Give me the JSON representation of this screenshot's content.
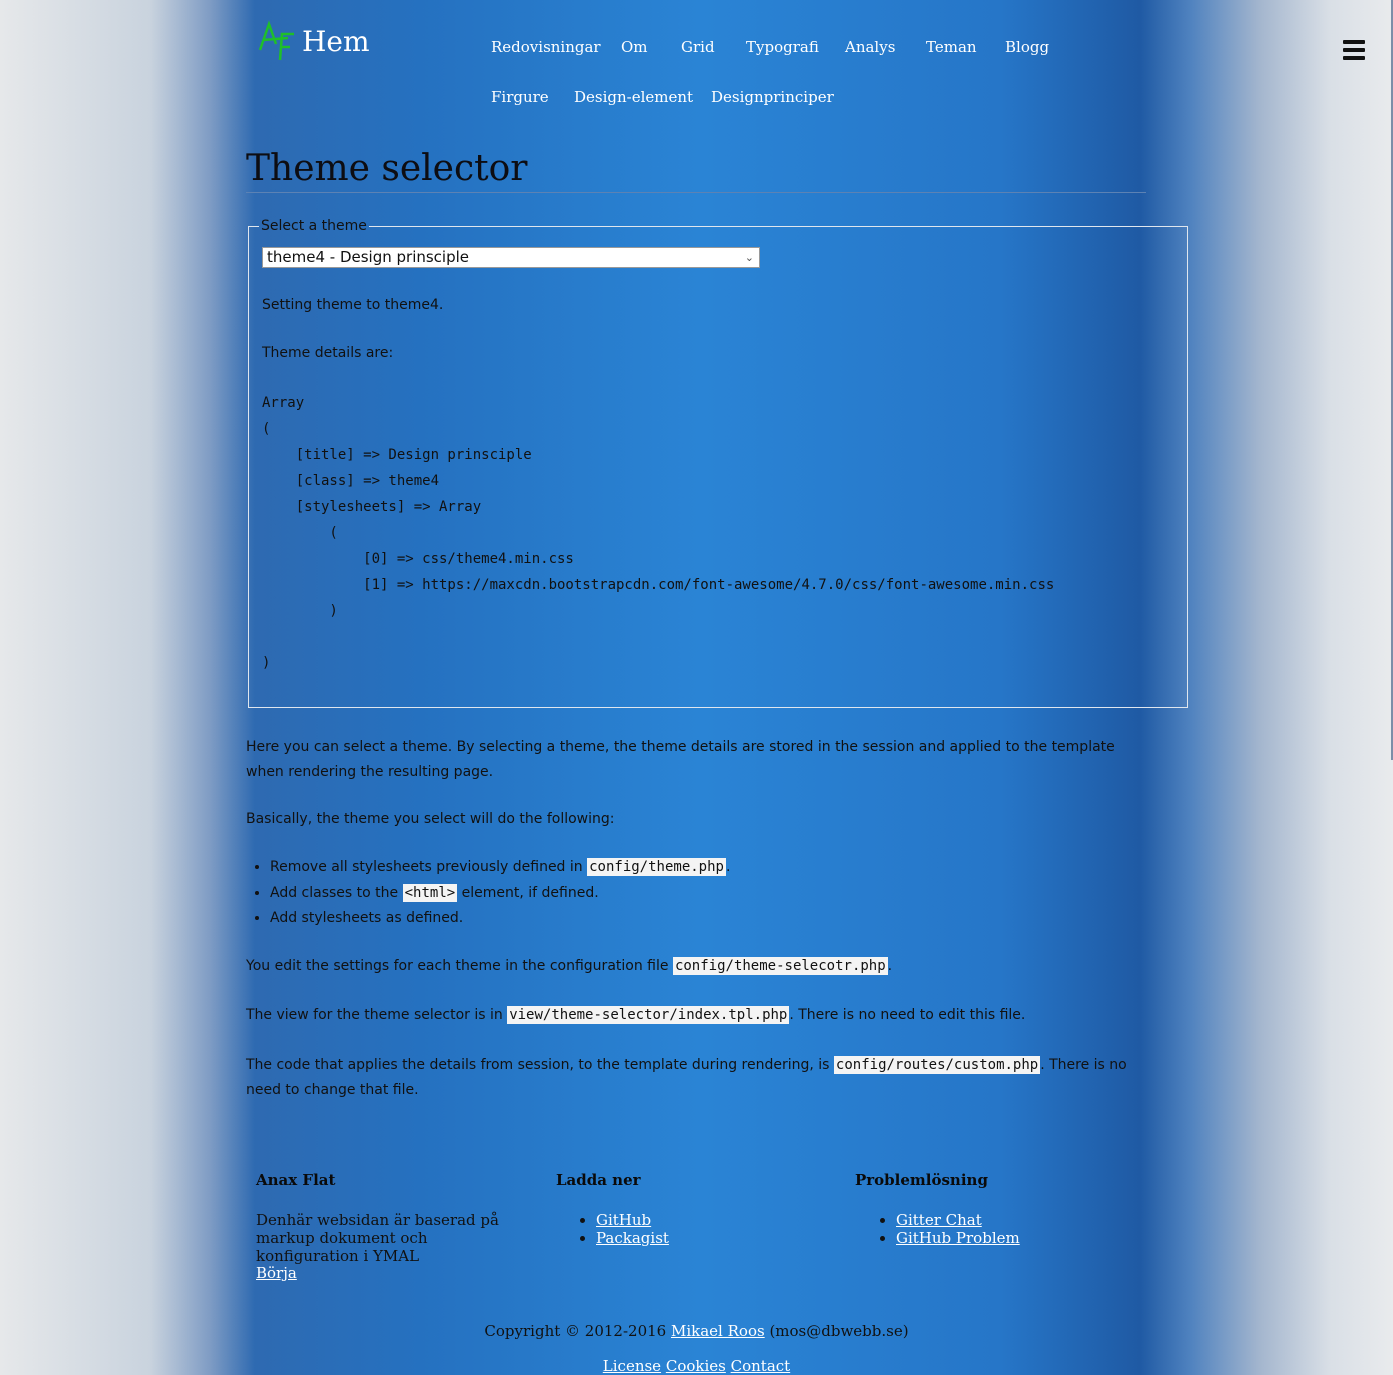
{
  "header": {
    "logo_text": "Hem",
    "nav": [
      "Redovisningar",
      "Om",
      "Grid",
      "Typografi",
      "Analys",
      "Teman",
      "Blogg",
      "Firgure",
      "Design-element",
      "Designprinciper"
    ]
  },
  "main": {
    "title": "Theme selector",
    "fieldset": {
      "legend": "Select a theme",
      "selected_option": "theme4 - Design prinsciple",
      "status": "Setting theme to theme4.",
      "details_label": "Theme details are:",
      "array_dump": "Array\n(\n    [title] => Design prinsciple\n    [class] => theme4\n    [stylesheets] => Array\n        (\n            [0] => css/theme4.min.css\n            [1] => https://maxcdn.bootstrapcdn.com/font-awesome/4.7.0/css/font-awesome.min.css\n        )\n\n)"
    },
    "intro": "Here you can select a theme. By selecting a theme, the theme details are stored in the session and applied to the template when rendering the resulting page.",
    "basically": "Basically, the theme you select will do the following:",
    "list": [
      {
        "pre": "Remove all stylesheets previously defined in ",
        "code": "config/theme.php",
        "post": "."
      },
      {
        "pre": "Add classes to the ",
        "code": "<html>",
        "post": " element, if defined."
      },
      {
        "pre": "Add stylesheets as defined.",
        "code": "",
        "post": ""
      }
    ],
    "p_edit": {
      "pre": "You edit the settings for each theme in the configuration file ",
      "code": "config/theme-selecotr.php",
      "post": "."
    },
    "p_view": {
      "pre": "The view for the theme selector is in ",
      "code": "view/theme-selector/index.tpl.php",
      "post": ". There is no need to edit this file."
    },
    "p_code": {
      "pre": "The code that applies the details from session, to the template during rendering, is ",
      "code": "config/routes/custom.php",
      "post": ". There is no need to change that file."
    }
  },
  "footer": {
    "col1": {
      "heading": "Anax Flat",
      "text": "Denhär websidan är baserad på markup dokument och konfiguration i YMAL",
      "link": "Börja"
    },
    "col2": {
      "heading": "Ladda ner",
      "links": [
        "GitHub",
        "Packagist"
      ]
    },
    "col3": {
      "heading": "Problemlösning",
      "links": [
        "Gitter Chat",
        "GitHub Problem"
      ]
    },
    "copyright_pre": "Copyright © 2012-2016 ",
    "copyright_name": "Mikael Roos",
    "copyright_post": " (mos@dbwebb.se)",
    "legal_links": [
      "License",
      "Cookies",
      "Contact"
    ]
  },
  "icons": {
    "logo": "af-logo-icon",
    "menu": "hamburger-menu-icon",
    "select": "chevron-down-icon"
  },
  "colors": {
    "logo_green": "#1fbf2a",
    "link": "#ffffff",
    "code_bg": "#f4f4f4"
  }
}
